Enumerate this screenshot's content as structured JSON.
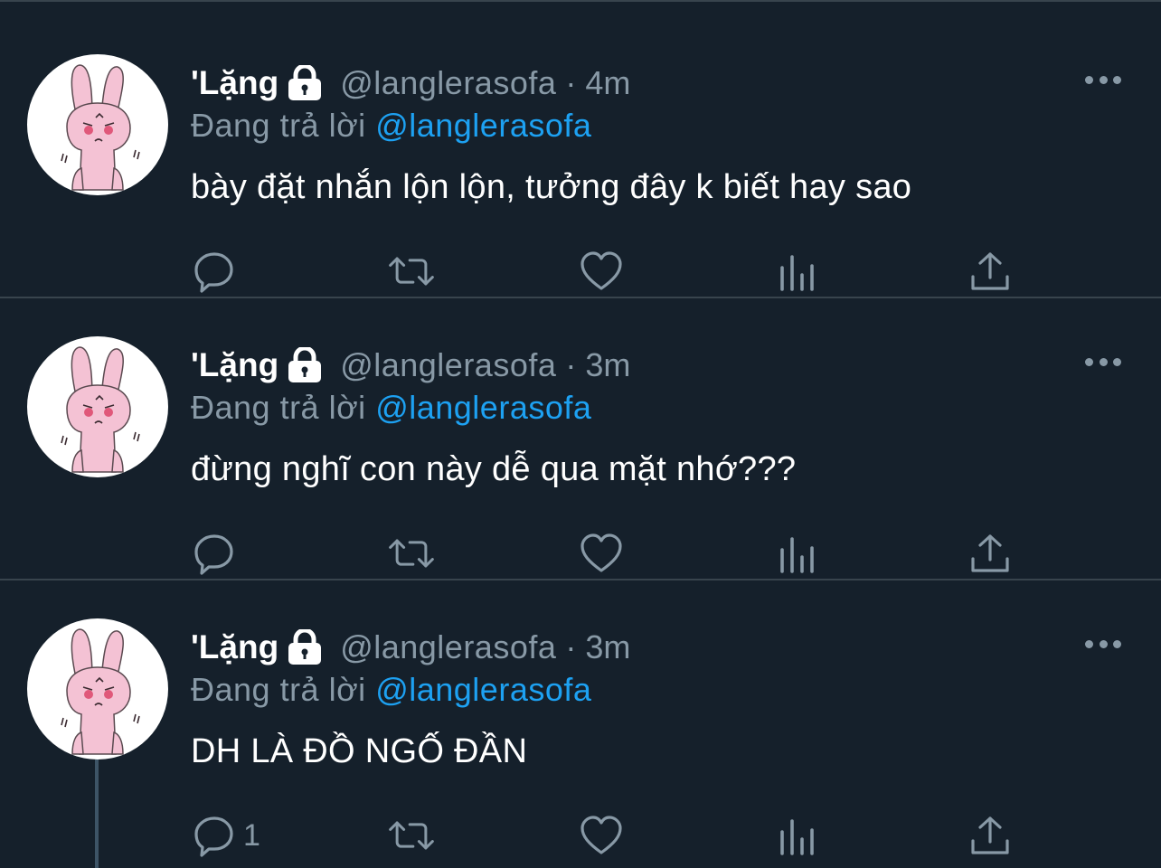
{
  "colors": {
    "background": "#15202b",
    "divider": "#38444d",
    "muted": "#8899a6",
    "link": "#1da1f2",
    "text": "#ffffff"
  },
  "tweets": [
    {
      "name": "'Lặng",
      "handle": "@langlerasofa",
      "separator": "·",
      "time": "4m",
      "replying_label": "Đang trả lời",
      "replying_to": "@langlerasofa",
      "text": "bày đặt nhắn lộn lộn, tưởng đây k biết hay sao",
      "reply_count": ""
    },
    {
      "name": "'Lặng",
      "handle": "@langlerasofa",
      "separator": "·",
      "time": "3m",
      "replying_label": "Đang trả lời",
      "replying_to": "@langlerasofa",
      "text": "đừng nghĩ con này dễ qua mặt nhớ???",
      "reply_count": ""
    },
    {
      "name": "'Lặng",
      "handle": "@langlerasofa",
      "separator": "·",
      "time": "3m",
      "replying_label": "Đang trả lời",
      "replying_to": "@langlerasofa",
      "text": "DH LÀ ĐỒ NGỐ ĐẦN",
      "reply_count": "1"
    }
  ],
  "icons": {
    "lock": "lock-icon",
    "more": "more-icon",
    "reply": "reply-icon",
    "retweet": "retweet-icon",
    "like": "heart-icon",
    "analytics": "analytics-icon",
    "share": "share-icon"
  }
}
